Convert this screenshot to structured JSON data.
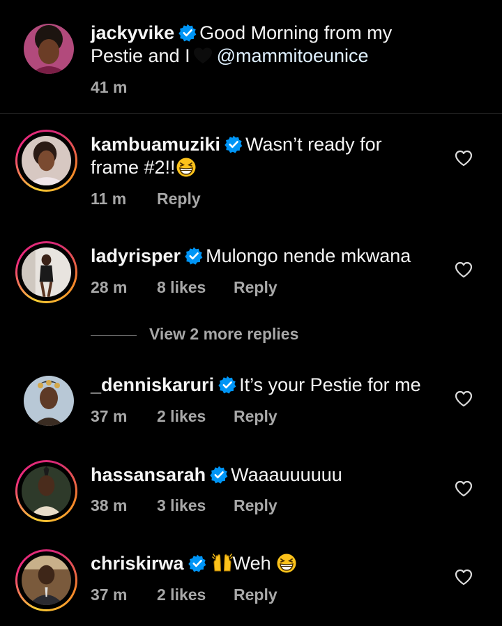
{
  "caption": {
    "username": "jackyvike",
    "text_part1": "Good Morning from my",
    "text_part2": "Pestie and I",
    "mention": "@mammitoeunice",
    "time": "41 m",
    "heart_icon": "black-heart-icon"
  },
  "comments": [
    {
      "username": "kambuamuziki",
      "text": "Wasn’t ready for",
      "text2": "frame #2!!",
      "emoji": "grinning-squinting-face-icon",
      "time": "11 m",
      "likes": "",
      "reply": "Reply"
    },
    {
      "username": "ladyrisper",
      "text": "Mulongo nende mkwana",
      "time": "28 m",
      "likes": "8 likes",
      "reply": "Reply"
    },
    {
      "username": "_denniskaruri",
      "text": "It’s your Pestie for me",
      "time": "37 m",
      "likes": "2 likes",
      "reply": "Reply"
    },
    {
      "username": "hassansarah",
      "text": "Waaauuuuuu",
      "time": "38 m",
      "likes": "3 likes",
      "reply": "Reply"
    },
    {
      "username": "chriskirwa",
      "text": "Weh",
      "emoji_before": "raising-hands-icon",
      "emoji_after": "grinning-squinting-face-icon",
      "time": "37 m",
      "likes": "2 likes",
      "reply": "Reply"
    }
  ],
  "view_more": "View 2 more replies",
  "colors": {
    "verified": "#0095f6",
    "ring_start": "#f9ce34",
    "ring_end": "#ee2a7b",
    "muted": "#a8a8a8"
  }
}
